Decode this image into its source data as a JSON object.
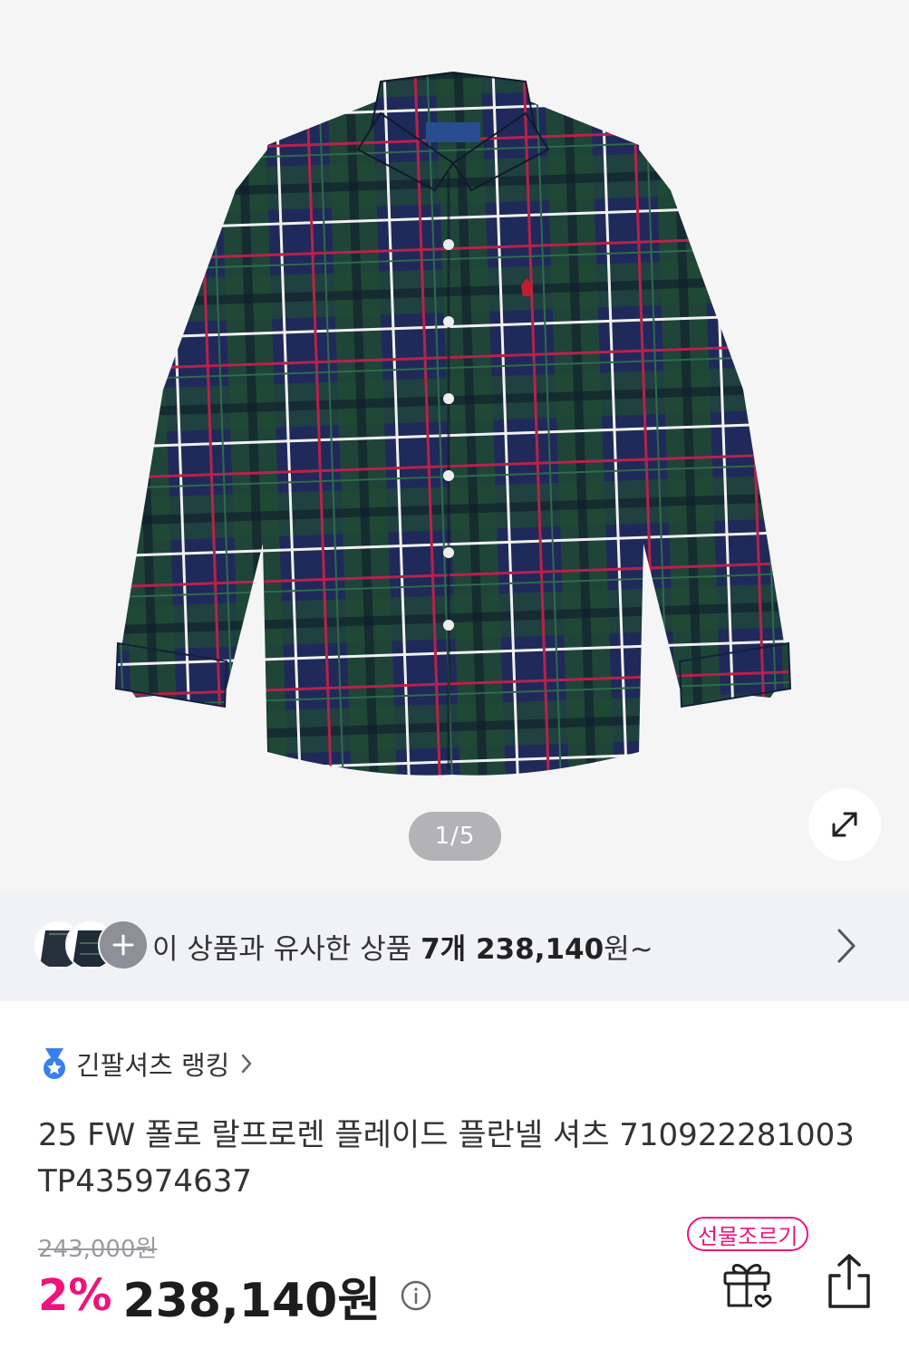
{
  "hero": {
    "image_alt": "플레이드 플란넬 셔츠",
    "pager": "1/5",
    "zoom_icon": "expand-icon",
    "colors": {
      "plaid_navy": "#1f2a5a",
      "plaid_green": "#1f4a34",
      "plaid_red": "#b8224a",
      "plaid_white": "#f1f1f1"
    }
  },
  "similar": {
    "prefix": "이 상품과 유사한 상품 ",
    "count": "7개 238,140",
    "suffix": "원~",
    "more_icon": "plus-icon",
    "chevron_icon": "chevron-right-icon"
  },
  "ranking": {
    "label": "긴팔셔츠 랭킹",
    "icon": "medal-icon"
  },
  "product": {
    "title": "25 FW 폴로 랄프로렌 플레이드 플란넬 셔츠 710922281003 TP435974637",
    "original_price": "243,000원",
    "discount": "2%",
    "price": "238,140원"
  },
  "actions": {
    "gift_badge": "선물조르기",
    "gift_icon": "gift-icon",
    "share_icon": "share-icon"
  },
  "theme": {
    "accent": "#f0127d",
    "strip_bg": "#f1f2f5",
    "hero_bg": "#f5f5f6"
  }
}
